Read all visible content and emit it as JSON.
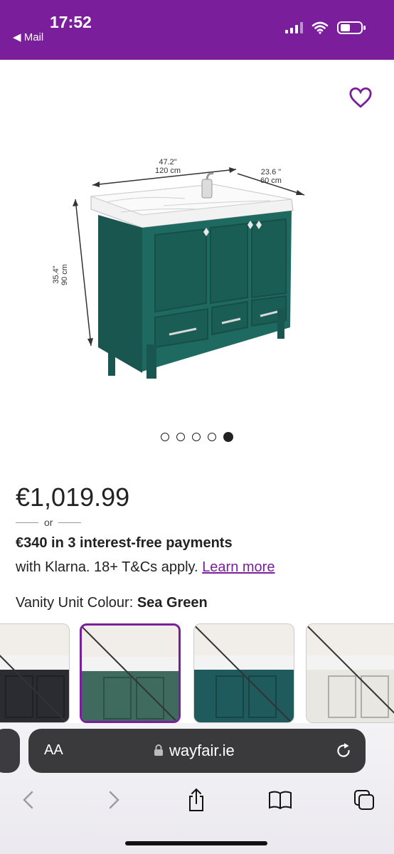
{
  "status": {
    "time": "17:52",
    "back_label": "◀ Mail"
  },
  "product": {
    "dimensions": {
      "width_in": "47.2\"",
      "width_cm": "120 cm",
      "depth_in": "23.6 \"",
      "depth_cm": "60 cm",
      "height_in": "35.4\"",
      "height_cm": "90 cm"
    },
    "gallery": {
      "total_images": 5,
      "active_index": 4
    },
    "price": "€1,019.99",
    "or_label": "or",
    "klarna_headline": "€340 in 3 interest-free payments",
    "klarna_sub": "with Klarna. 18+ T&Cs apply.",
    "learn_more": "Learn more",
    "colour_label": "Vanity Unit Colour:",
    "colour_value": "Sea Green"
  },
  "swatches": [
    {
      "name": "Black",
      "color": "#2a2c31",
      "selected": false
    },
    {
      "name": "Sea Green",
      "color": "#3f6b5e",
      "selected": true
    },
    {
      "name": "Teal",
      "color": "#1f5b5c",
      "selected": false
    },
    {
      "name": "White",
      "color": "#e9e7e1",
      "selected": false
    }
  ],
  "browser": {
    "aa_label": "AA",
    "domain": "wayfair.ie"
  },
  "colors": {
    "brand": "#7b1e9c",
    "cabinet": "#1f6a60"
  }
}
